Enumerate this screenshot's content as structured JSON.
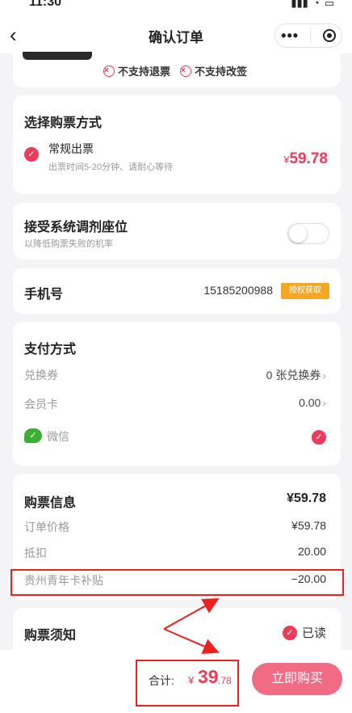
{
  "status": {
    "time": "11:30"
  },
  "nav": {
    "title": "确认订单",
    "back_icon": "chevron-left-icon",
    "more_glyph": "•••"
  },
  "ticket_restrictions": [
    "不支持退票",
    "不支持改签"
  ],
  "ticket_type": {
    "title": "选择购票方式",
    "option_name": "常规出票",
    "option_desc": "出票时间5-20分钟、请耐心等待",
    "currency": "¥",
    "price": "59.78"
  },
  "seat_adjust": {
    "title": "接受系统调剂座位",
    "desc": "以降低购票失败的机率",
    "enabled": false
  },
  "phone": {
    "label": "手机号",
    "number": "15185200988",
    "auth_button": "授权获取"
  },
  "payment": {
    "title": "支付方式",
    "coupon_label": "兑换券",
    "coupon_value": "0 张兑换券",
    "member_label": "会员卡",
    "member_value": "0.00",
    "wechat_label": "微信",
    "chevron": "›"
  },
  "price_info": {
    "title": "购票信息",
    "total": "¥59.78",
    "rows": [
      {
        "label": "订单价格",
        "value": "¥59.78"
      },
      {
        "label": "抵扣",
        "value": "20.00"
      },
      {
        "label": "贵州青年卡补贴",
        "value": "−20.00"
      }
    ]
  },
  "notice": {
    "title": "购票须知",
    "read_label": "已读"
  },
  "bottom": {
    "total_label": "合计:",
    "currency": "¥",
    "total_int": "39",
    "total_dec": ".78",
    "buy_button": "立即购买"
  },
  "colors": {
    "accent": "#ee3a5b",
    "annotation": "#ee2020",
    "wechat": "#3cb034",
    "auth": "#f5a623"
  }
}
